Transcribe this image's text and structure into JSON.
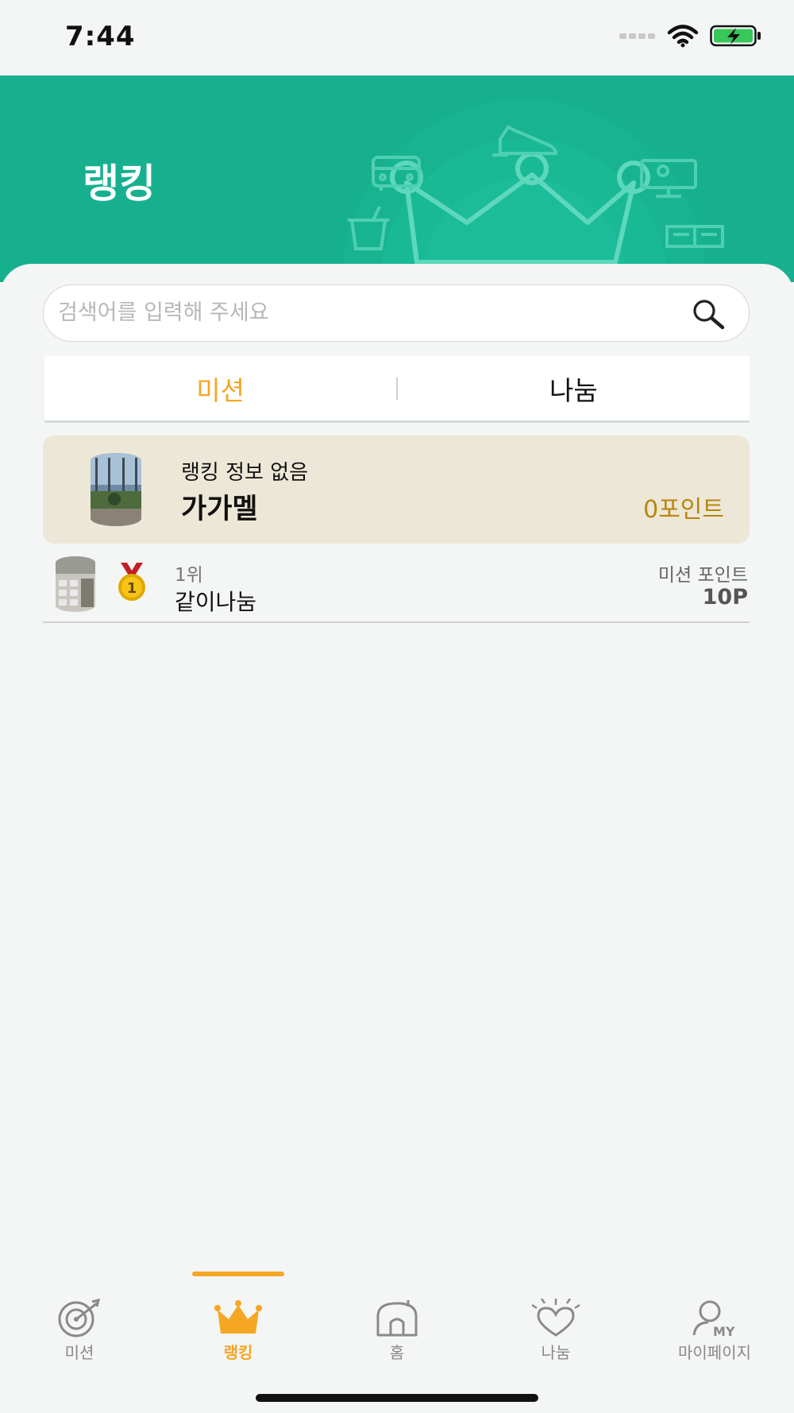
{
  "status_bar": {
    "time": "7:44"
  },
  "header": {
    "title": "랭킹"
  },
  "search": {
    "placeholder": "검색어를 입력해 주세요",
    "value": ""
  },
  "tabs": [
    {
      "label": "미션",
      "active": true
    },
    {
      "label": "나눔",
      "active": false
    }
  ],
  "my_ranking": {
    "rank_text": "랭킹 정보 없음",
    "name": "가가멜",
    "points": "0포인트"
  },
  "ranking_list": [
    {
      "rank": "1위",
      "name": "같이나눔",
      "points_label": "미션 포인트",
      "points": "10P",
      "medal": "gold-medal-icon"
    }
  ],
  "bottom_nav": [
    {
      "label": "미션",
      "icon": "target-icon",
      "active": false
    },
    {
      "label": "랭킹",
      "icon": "crown-icon",
      "active": true
    },
    {
      "label": "홈",
      "icon": "home-icon",
      "active": false
    },
    {
      "label": "나눔",
      "icon": "heart-icon",
      "active": false
    },
    {
      "label": "마이페이지",
      "icon": "my-person-icon",
      "active": false
    }
  ],
  "colors": {
    "header": "#17b08f",
    "accent": "#f5a623",
    "my_card": "#ede7d7",
    "points": "#b7860b"
  }
}
